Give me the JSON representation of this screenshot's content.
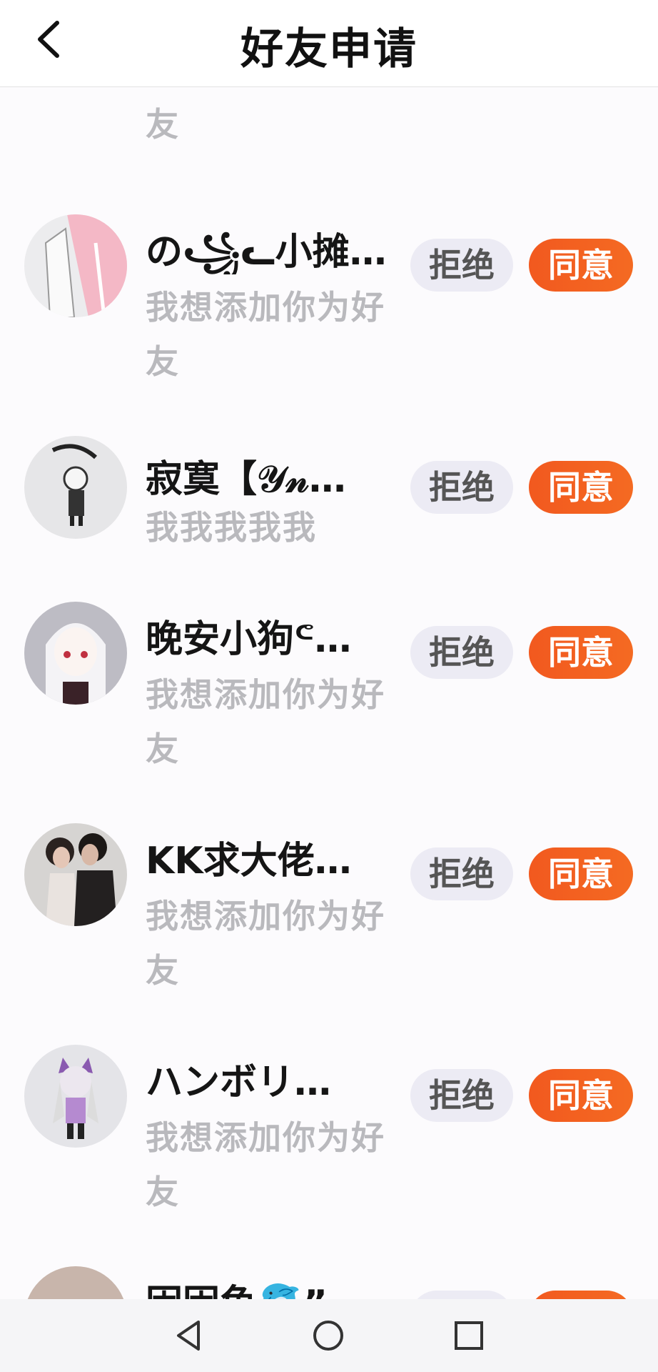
{
  "header": {
    "title": "好友申请"
  },
  "requests": [
    {
      "name": "",
      "message": "我想添加你为好友"
    },
    {
      "name": "の꧁ᓚ小摊…",
      "message": "我想添加你为好友"
    },
    {
      "name": "寂寞【𝒴𝓃…",
      "message": "我我我我我"
    },
    {
      "name": "晚安小狗ᕪ…",
      "message": "我想添加你为好友"
    },
    {
      "name": "KK求大佬…",
      "message": "我想添加你为好友"
    },
    {
      "name": "ハンボリ…",
      "message": "我想添加你为好友"
    },
    {
      "name": "困困鱼🐬”",
      "message": ""
    }
  ],
  "actions": {
    "reject_label": "拒绝",
    "accept_label": "同意"
  },
  "icons": {
    "back": "chevron-left-icon",
    "nav_back": "triangle-back-icon",
    "nav_home": "circle-home-icon",
    "nav_recent": "square-recent-icon"
  },
  "colors": {
    "accept": "#f2591f",
    "reject_bg": "#ecebf4",
    "message": "#b9b9bd"
  }
}
